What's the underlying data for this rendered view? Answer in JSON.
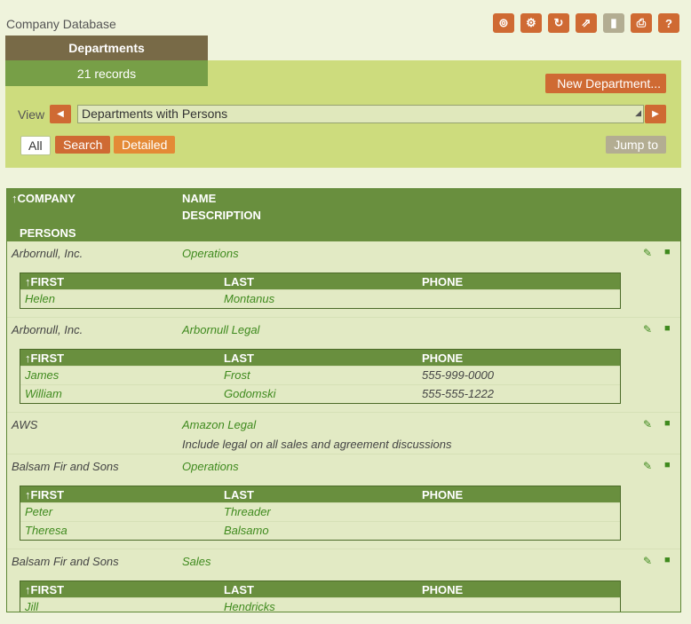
{
  "app": {
    "title": "Company Database"
  },
  "toolbar": {
    "buttons": [
      {
        "icon": "fingerprint-icon",
        "glyph": "⊚"
      },
      {
        "icon": "gear-icon",
        "glyph": "⚙"
      },
      {
        "icon": "refresh-icon",
        "glyph": "↻"
      },
      {
        "icon": "export-icon",
        "glyph": "⇗"
      },
      {
        "icon": "chart-icon",
        "glyph": "▮",
        "disabled": true
      },
      {
        "icon": "print-icon",
        "glyph": "⎙"
      },
      {
        "icon": "help-icon",
        "glyph": "?"
      }
    ]
  },
  "tab": {
    "title": "Departments",
    "count": "21 records"
  },
  "panel": {
    "new_button": "New Department...",
    "view_label": "View",
    "view_value": "Departments with Persons",
    "filters": {
      "all": "All",
      "search": "Search",
      "detailed": "Detailed"
    },
    "jump_to": "Jump to"
  },
  "table": {
    "headers": {
      "company": "↑COMPANY",
      "name": "NAME",
      "description": "DESCRIPTION",
      "persons": "PERSONS"
    },
    "sub_headers": {
      "first": "↑FIRST",
      "last": "LAST",
      "phone": "PHONE"
    },
    "records": [
      {
        "company": "Arbornull, Inc.",
        "name": "Operations",
        "description": "",
        "persons": [
          {
            "first": "Helen",
            "last": "Montanus",
            "phone": ""
          }
        ]
      },
      {
        "company": "Arbornull, Inc.",
        "name": "Arbornull Legal",
        "description": "",
        "persons": [
          {
            "first": "James",
            "last": "Frost",
            "phone": "555-999-0000"
          },
          {
            "first": "William",
            "last": "Godomski",
            "phone": "555-555-1222"
          }
        ]
      },
      {
        "company": "AWS",
        "name": "Amazon Legal",
        "description": "Include legal on all sales and agreement discussions",
        "persons": []
      },
      {
        "company": "Balsam Fir and Sons",
        "name": "Operations",
        "description": "",
        "persons": [
          {
            "first": "Peter",
            "last": "Threader",
            "phone": ""
          },
          {
            "first": "Theresa",
            "last": "Balsamo",
            "phone": ""
          }
        ]
      },
      {
        "company": "Balsam Fir and Sons",
        "name": "Sales",
        "description": "",
        "persons": [
          {
            "first": "Jill",
            "last": "Hendricks",
            "phone": ""
          }
        ]
      }
    ]
  },
  "colors": {
    "accent": "#cf6a33",
    "header_green": "#698f3e",
    "panel": "#cddc7d",
    "link_green": "#3f8a1e"
  }
}
